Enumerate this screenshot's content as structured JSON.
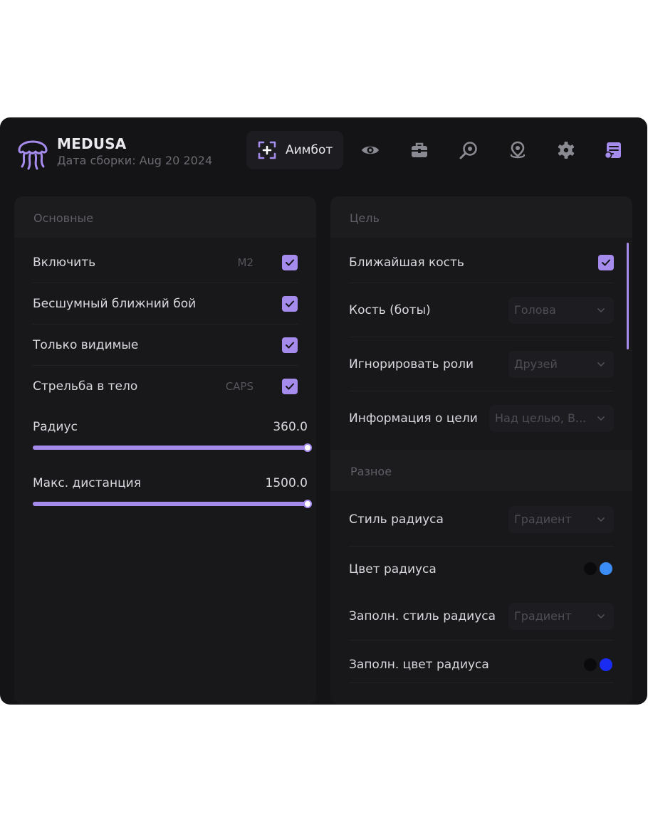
{
  "app": {
    "name": "MEDUSA",
    "build": "Дата сборки: Aug 20 2024"
  },
  "tabs": {
    "active_label": "Аимбот",
    "icons": [
      "aimbot-icon",
      "eye-icon",
      "briefcase-icon",
      "radar-icon",
      "map-pin-icon",
      "gear-icon",
      "config-icon"
    ]
  },
  "main": {
    "title": "Основные",
    "rows": [
      {
        "label": "Включить",
        "key": "M2",
        "checked": true
      },
      {
        "label": "Бесшумный ближний бой",
        "key": "",
        "checked": true
      },
      {
        "label": "Только видимые",
        "key": "",
        "checked": true
      },
      {
        "label": "Стрельба в тело",
        "key": "CAPS",
        "checked": true
      }
    ],
    "sliders": [
      {
        "label": "Радиус",
        "value": "360.0",
        "fill": 1.0
      },
      {
        "label": "Макс. дистанция",
        "value": "1500.0",
        "fill": 1.0
      }
    ]
  },
  "target": {
    "title": "Цель",
    "nearest_bone": {
      "label": "Ближайшая кость",
      "checked": true
    },
    "bone_bots": {
      "label": "Кость (боты)",
      "value": "Голова"
    },
    "ignore_roles": {
      "label": "Игнорировать роли",
      "value": "Друзей"
    },
    "target_info": {
      "label": "Информация о цели",
      "value": "Над целью, В..."
    }
  },
  "misc": {
    "title": "Разное",
    "radius_style": {
      "label": "Стиль радиуса",
      "value": "Градиент"
    },
    "radius_color": {
      "label": "Цвет радиуса",
      "colors": [
        "#0a0a0c",
        "#3b8cf5"
      ]
    },
    "fill_radius_style": {
      "label": "Заполн. стиль радиуса",
      "value": "Градиент"
    },
    "fill_radius_color": {
      "label": "Заполн. цвет радиуса",
      "colors": [
        "#0a0a0c",
        "#1a2cf2"
      ]
    }
  },
  "theme": {
    "accent": "#a48bec",
    "background": "#141416"
  }
}
